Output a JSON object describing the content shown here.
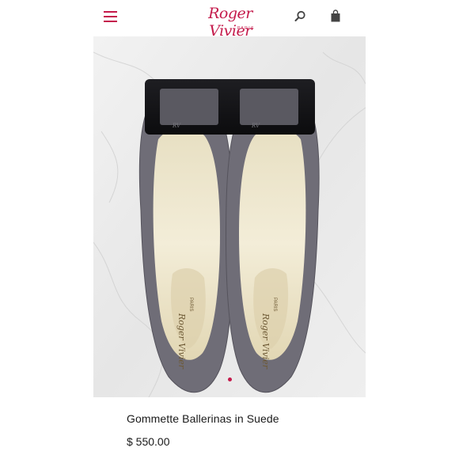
{
  "header": {
    "brand_script": "Roger Vivier",
    "brand_sub": "PARIS",
    "icons": [
      "menu-icon",
      "search-icon",
      "shopping-bag-icon"
    ]
  },
  "gallery": {
    "active_slide": 1,
    "slide_count": 1,
    "insole_text_top": "PARIS",
    "insole_script": "Roger Vivier",
    "buckle_monogram": "RV"
  },
  "product": {
    "name": "Gommette Ballerinas in Suede",
    "price": "$ 550.00"
  },
  "colors": {
    "accent": "#c41a4b",
    "text": "#1a1a1a",
    "suede": "#6f6d77"
  }
}
